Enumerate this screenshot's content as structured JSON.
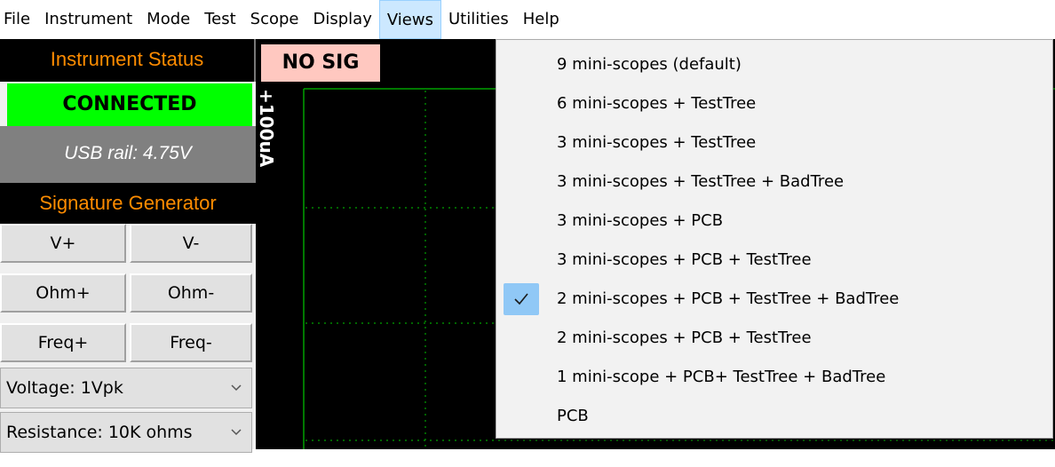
{
  "menubar": {
    "items": [
      "File",
      "Instrument",
      "Mode",
      "Test",
      "Scope",
      "Display",
      "Views",
      "Utilities",
      "Help"
    ],
    "active": "Views"
  },
  "left_panel": {
    "instrument_status_title": "Instrument Status",
    "connection_status": "CONNECTED",
    "connection_color": "#00ff00",
    "usb_rail": "USB rail: 4.75V",
    "signature_generator_title": "Signature Generator",
    "buttons": [
      {
        "left": "V+",
        "right": "V-"
      },
      {
        "left": "Ohm+",
        "right": "Ohm-"
      },
      {
        "left": "Freq+",
        "right": "Freq-"
      }
    ],
    "voltage_select": "Voltage: 1Vpk",
    "resistance_select": "Resistance: 10K ohms",
    "header_text_color": "#ff8c00"
  },
  "scope": {
    "signal_badge": "NO SIG",
    "axis_label": "+100uA",
    "grid_color": "#00a000"
  },
  "views_menu": {
    "items": [
      "9 mini-scopes (default)",
      "6 mini-scopes + TestTree",
      "3 mini-scopes + TestTree",
      "3 mini-scopes + TestTree + BadTree",
      "3 mini-scopes + PCB",
      "3 mini-scopes + PCB + TestTree",
      "2 mini-scopes + PCB + TestTree + BadTree",
      "2 mini-scopes + PCB + TestTree",
      "1 mini-scope + PCB+ TestTree + BadTree",
      "PCB"
    ],
    "checked_item": "2 mini-scopes + PCB + TestTree + BadTree"
  },
  "icons": {
    "checkmark": "checkmark-icon",
    "combo_chevron": "chevron-down-icon"
  }
}
